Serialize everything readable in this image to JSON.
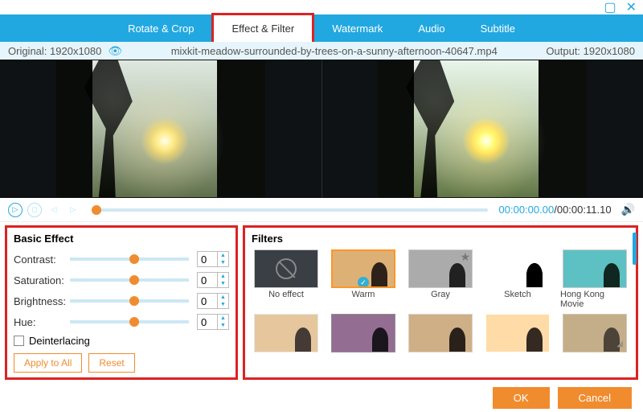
{
  "window": {
    "minimize": "▢",
    "close": "✕"
  },
  "tabs": [
    "Rotate & Crop",
    "Effect & Filter",
    "Watermark",
    "Audio",
    "Subtitle"
  ],
  "active_tab": 1,
  "info": {
    "original": "Original: 1920x1080",
    "filename": "mixkit-meadow-surrounded-by-trees-on-a-sunny-afternoon-40647.mp4",
    "output": "Output: 1920x1080"
  },
  "time": {
    "current": "00:00:00.00",
    "sep": "/",
    "total": "00:00:11.10"
  },
  "basic": {
    "title": "Basic Effect",
    "rows": [
      {
        "label": "Contrast:",
        "value": "0"
      },
      {
        "label": "Saturation:",
        "value": "0"
      },
      {
        "label": "Brightness:",
        "value": "0"
      },
      {
        "label": "Hue:",
        "value": "0"
      }
    ],
    "deinterlacing": "Deinterlacing",
    "apply": "Apply to All",
    "reset": "Reset"
  },
  "filters": {
    "title": "Filters",
    "items": [
      {
        "label": "No effect"
      },
      {
        "label": "Warm",
        "selected": true
      },
      {
        "label": "Gray",
        "star": true
      },
      {
        "label": "Sketch"
      },
      {
        "label": "Hong Kong Movie"
      },
      {
        "label": ""
      },
      {
        "label": ""
      },
      {
        "label": ""
      },
      {
        "label": ""
      },
      {
        "label": ""
      }
    ]
  },
  "footer": {
    "ok": "OK",
    "cancel": "Cancel"
  }
}
